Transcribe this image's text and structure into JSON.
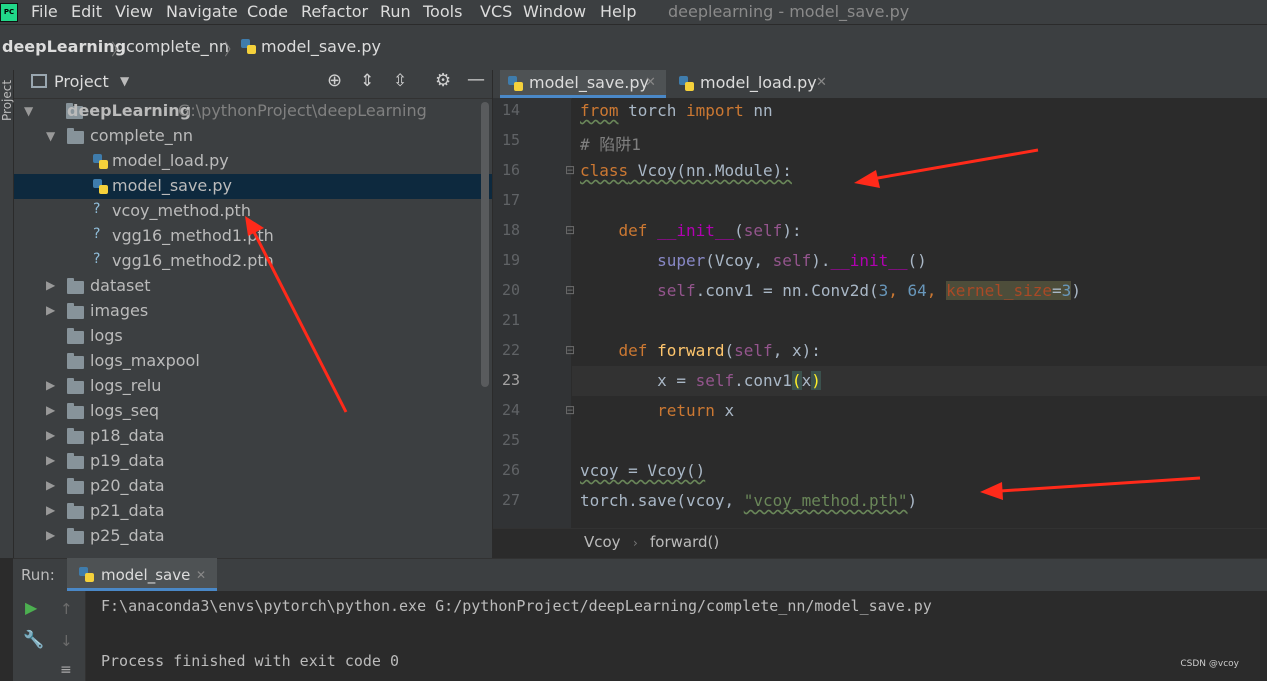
{
  "menu": {
    "items": [
      "File",
      "Edit",
      "View",
      "Navigate",
      "Code",
      "Refactor",
      "Run",
      "Tools",
      "VCS",
      "Window",
      "Help"
    ],
    "window_title": "deeplearning - model_save.py"
  },
  "breadcrumb": [
    "deepLearning",
    "complete_nn",
    "model_save.py"
  ],
  "left_stripe": {
    "label": "Project"
  },
  "project_panel": {
    "title": "Project",
    "tree": [
      {
        "label": "deepLearning",
        "hint": "G:\\pythonProject\\deepLearning",
        "type": "root"
      },
      {
        "label": "complete_nn",
        "type": "folder-open"
      },
      {
        "label": "model_load.py",
        "type": "py"
      },
      {
        "label": "model_save.py",
        "type": "py",
        "selected": true
      },
      {
        "label": "vcoy_method.pth",
        "type": "unknown"
      },
      {
        "label": "vgg16_method1.pth",
        "type": "unknown"
      },
      {
        "label": "vgg16_method2.pth",
        "type": "unknown"
      },
      {
        "label": "dataset",
        "type": "folder"
      },
      {
        "label": "images",
        "type": "folder"
      },
      {
        "label": "logs",
        "type": "folder-leaf"
      },
      {
        "label": "logs_maxpool",
        "type": "folder-leaf"
      },
      {
        "label": "logs_relu",
        "type": "folder"
      },
      {
        "label": "logs_seq",
        "type": "folder"
      },
      {
        "label": "p18_data",
        "type": "folder"
      },
      {
        "label": "p19_data",
        "type": "folder"
      },
      {
        "label": "p20_data",
        "type": "folder"
      },
      {
        "label": "p21_data",
        "type": "folder"
      },
      {
        "label": "p25_data",
        "type": "folder"
      }
    ]
  },
  "editor": {
    "tabs": [
      {
        "label": "model_save.py",
        "active": true
      },
      {
        "label": "model_load.py",
        "active": false
      }
    ],
    "line_numbers": [
      "14",
      "15",
      "16",
      "17",
      "18",
      "19",
      "20",
      "21",
      "22",
      "23",
      "24",
      "25",
      "26",
      "27"
    ],
    "current_line": "23",
    "code": {
      "l14": {
        "kw_from": "from",
        "mod": " torch ",
        "kw_import": "import",
        "name": " nn"
      },
      "l15": {
        "comment": "# 陷阱1"
      },
      "l16": {
        "kw": "class",
        "rest": " Vcoy(nn.Module):"
      },
      "l18": {
        "kw": "def",
        "name": "__init__",
        "open": "(",
        "self": "self",
        "close": "):"
      },
      "l19": {
        "builtin": "super",
        "args_a": "(Vcoy, ",
        "self": "self",
        "dot": ").",
        "dunder": "__init__",
        "end": "()"
      },
      "l20": {
        "self": "self",
        "mid": ".conv1 = nn.Conv2d(",
        "n1": "3",
        "c1": ", ",
        "n2": "64",
        "c2": ", ",
        "param": "kernel_size",
        "eq": "=",
        "n3": "3",
        "end": ")"
      },
      "l22": {
        "kw": "def",
        "name": "forward",
        "open": "(",
        "self": "self",
        "rest": ", x):"
      },
      "l23": {
        "pre": "x = ",
        "self": "self",
        "mid": ".conv1",
        "paren": "(",
        "x": "x",
        "end": ")"
      },
      "l24": {
        "kw": "return",
        "rest": " x"
      },
      "l26": {
        "text": "vcoy = Vcoy()"
      },
      "l27": {
        "pre": "torch.save(vcoy, ",
        "str": "\"vcoy_method.pth\"",
        "end": ")"
      }
    },
    "breadcrumb": [
      "Vcoy",
      "forward()"
    ]
  },
  "run_panel": {
    "label": "Run:",
    "tab": "model_save",
    "console": [
      "F:\\anaconda3\\envs\\pytorch\\python.exe G:/pythonProject/deepLearning/complete_nn/model_save.py",
      "Process finished with exit code 0"
    ]
  },
  "watermark": "CSDN @vcoy",
  "colors": {
    "accent": "#4a88c7",
    "annotation_arrow": "#ff2a1a",
    "keyword": "#cc7832",
    "string": "#6a8759"
  }
}
